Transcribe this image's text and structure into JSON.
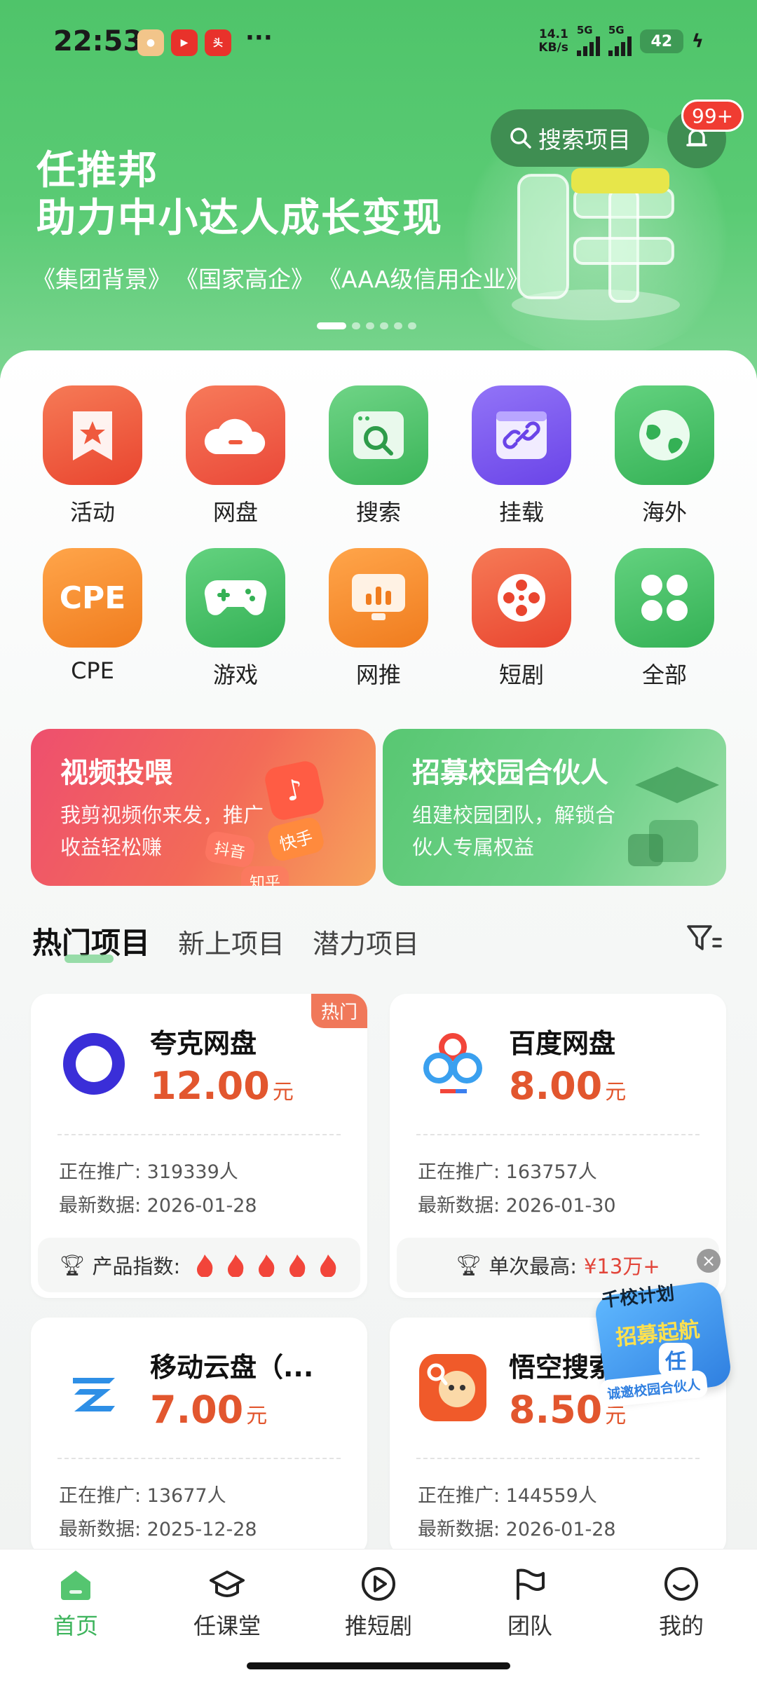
{
  "status": {
    "time": "22:53",
    "net_speed_top": "14.1",
    "net_speed_unit": "KB/s",
    "sim1": "5G",
    "sim2": "5G",
    "battery": "42",
    "more": "···"
  },
  "header": {
    "search_label": "搜索项目",
    "notif_badge": "99+",
    "brand_logo_text": "任"
  },
  "banner": {
    "title_line1": "任推邦",
    "title_line2": "助力中小达人成长变现",
    "tags": [
      "集团背景",
      "国家高企",
      "AAA级信用企业"
    ],
    "slide_count": 6,
    "active_slide": 1
  },
  "categories": [
    {
      "label": "活动",
      "icon": "bookmark-star-icon",
      "color": "#ef5a3e"
    },
    {
      "label": "网盘",
      "icon": "cloud-icon",
      "color": "#f05c47"
    },
    {
      "label": "搜索",
      "icon": "search-window-icon",
      "color": "#47be63"
    },
    {
      "label": "挂载",
      "icon": "link-icon",
      "color": "#7b5bf0"
    },
    {
      "label": "海外",
      "icon": "globe-icon",
      "color": "#3fbd5e"
    },
    {
      "label": "CPE",
      "icon": "cpe-text-icon",
      "color": "#f58b2a"
    },
    {
      "label": "游戏",
      "icon": "gamepad-icon",
      "color": "#3fbd5e"
    },
    {
      "label": "网推",
      "icon": "monitor-chart-icon",
      "color": "#f58b2a"
    },
    {
      "label": "短剧",
      "icon": "film-reel-icon",
      "color": "#ef5a3e"
    },
    {
      "label": "全部",
      "icon": "grid-all-icon",
      "color": "#3fbd5e"
    }
  ],
  "cpe_icon_text": "CPE",
  "promos": [
    {
      "title": "视频投喂",
      "desc": "我剪视频你来发，推广收益轻松赚",
      "deco": [
        "抖音",
        "快手",
        "知乎"
      ]
    },
    {
      "title": "招募校园合伙人",
      "desc": "组建校园团队，解锁合伙人专属权益"
    }
  ],
  "tabs": [
    "热门项目",
    "新上项目",
    "潜力项目"
  ],
  "cards": [
    {
      "name": "夸克网盘",
      "price": "12.00",
      "unit": "元",
      "promoting": "正在推广: 319339人",
      "latest": "最新数据: 2026-01-28",
      "foot_label": "产品指数:",
      "flames": 5,
      "hot": "热门"
    },
    {
      "name": "百度网盘",
      "price": "8.00",
      "unit": "元",
      "promoting": "正在推广: 163757人",
      "latest": "最新数据: 2026-01-30",
      "foot_label": "单次最高:",
      "foot_value": "¥13万+"
    },
    {
      "name": "移动云盘（...",
      "price": "7.00",
      "unit": "元",
      "promoting": "正在推广: 13677人",
      "latest": "最新数据: 2025-12-28"
    },
    {
      "name": "悟空搜索",
      "price": "8.50",
      "unit": "元",
      "promoting": "正在推广: 144559人",
      "latest": "最新数据: 2026-01-28"
    }
  ],
  "floating_ad": {
    "line1": "千校计划",
    "line2": "招募起航",
    "line3": "诚邀校园合伙人",
    "logo_text": "任"
  },
  "close_label": "×",
  "nav": [
    {
      "label": "首页",
      "icon": "home-icon",
      "active": true
    },
    {
      "label": "任课堂",
      "icon": "graduation-cap-icon"
    },
    {
      "label": "推短剧",
      "icon": "play-circle-icon"
    },
    {
      "label": "团队",
      "icon": "flag-icon"
    },
    {
      "label": "我的",
      "icon": "smile-face-icon"
    }
  ],
  "colors": {
    "brand_green": "#4fc46a",
    "price_orange": "#e2562e",
    "active_nav": "#3db45c"
  }
}
